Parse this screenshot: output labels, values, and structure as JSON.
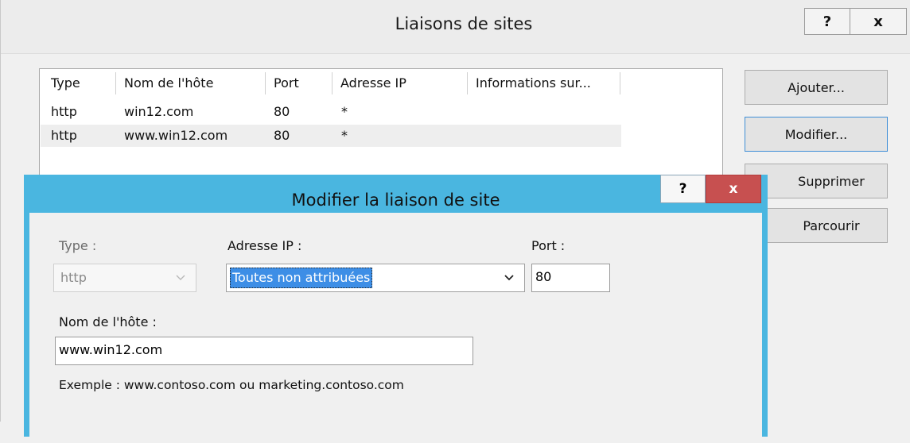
{
  "outer": {
    "title": "Liaisons de sites",
    "help_label": "?",
    "close_label": "x",
    "columns": [
      "Type",
      "Nom de l'hôte",
      "Port",
      "Adresse IP",
      "Informations sur..."
    ],
    "rows": [
      {
        "type": "http",
        "host": "win12.com",
        "port": "80",
        "ip": "*",
        "info": ""
      },
      {
        "type": "http",
        "host": "www.win12.com",
        "port": "80",
        "ip": "*",
        "info": ""
      }
    ],
    "buttons": {
      "add": "Ajouter...",
      "modify": "Modifier...",
      "remove": "Supprimer",
      "browse": "Parcourir"
    }
  },
  "inner": {
    "title": "Modifier la liaison de site",
    "help_label": "?",
    "close_label": "x",
    "type_label": "Type :",
    "type_value": "http",
    "ip_label": "Adresse IP :",
    "ip_value": "Toutes non attribuées",
    "port_label": "Port :",
    "port_value": "80",
    "host_label": "Nom de l'hôte :",
    "host_value": "www.win12.com",
    "example_text": "Exemple : www.contoso.com ou marketing.contoso.com"
  },
  "colors": {
    "inner_frame": "#4ab6e0",
    "close_red": "#c75050",
    "selection_blue": "#3d8ee6"
  }
}
